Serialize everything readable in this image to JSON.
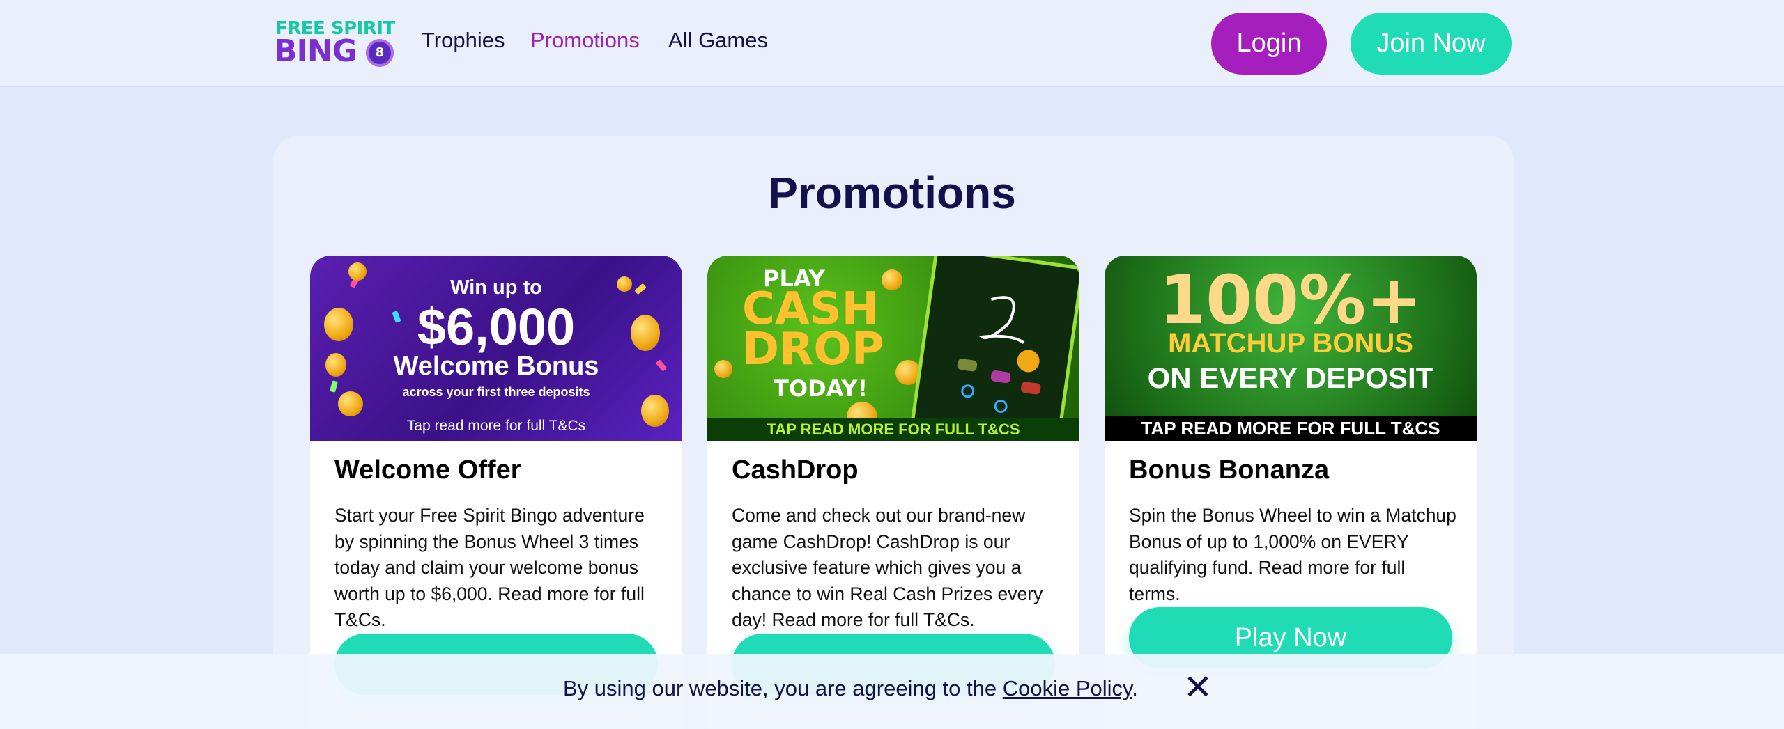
{
  "header": {
    "logo_top": "FREE SPIRIT",
    "logo_bottom": "BING",
    "logo_ball": "8",
    "nav": [
      "Trophies",
      "Promotions",
      "All Games"
    ],
    "login_label": "Login",
    "join_label": "Join Now"
  },
  "main": {
    "title": "Promotions",
    "cards": [
      {
        "image_text": {
          "line1": "Win up to",
          "line2": "$6,000",
          "line3": "Welcome Bonus",
          "line4": "across your first three deposits",
          "line5": "Tap read more for full T&Cs"
        },
        "title": "Welcome Offer",
        "description": "Start your Free Spirit Bingo adventure by spinning the Bonus Wheel 3 times today and claim your welcome bonus worth up to $6,000. Read more for full T&Cs."
      },
      {
        "image_text": {
          "line1": "PLAY",
          "line2": "CASH",
          "line3": "DROP",
          "line4": "TODAY!",
          "band": "TAP READ MORE FOR FULL T&CS"
        },
        "title": "CashDrop",
        "description": "Come and check out our brand-new game CashDrop! CashDrop is our exclusive feature which gives you a chance to win Real Cash Prizes every day! Read more for full T&Cs."
      },
      {
        "image_text": {
          "line1": "100%+",
          "line2": "MATCHUP BONUS",
          "line3": "ON EVERY DEPOSIT",
          "band": "TAP READ MORE FOR FULL T&CS"
        },
        "title": "Bonus Bonanza",
        "description": "Spin the Bonus Wheel to win a Matchup Bonus of up to 1,000% on EVERY qualifying fund. Read more for full terms.",
        "button_label": "Play Now"
      }
    ]
  },
  "cookie": {
    "text_before": "By using our website, you are agreeing to the ",
    "link": "Cookie Policy",
    "text_after": ".",
    "close": "✕"
  },
  "colors": {
    "accent_purple": "#a51fbf",
    "accent_teal": "#1fdcb6",
    "navy": "#11114d"
  },
  "icons": [
    "close-icon"
  ]
}
